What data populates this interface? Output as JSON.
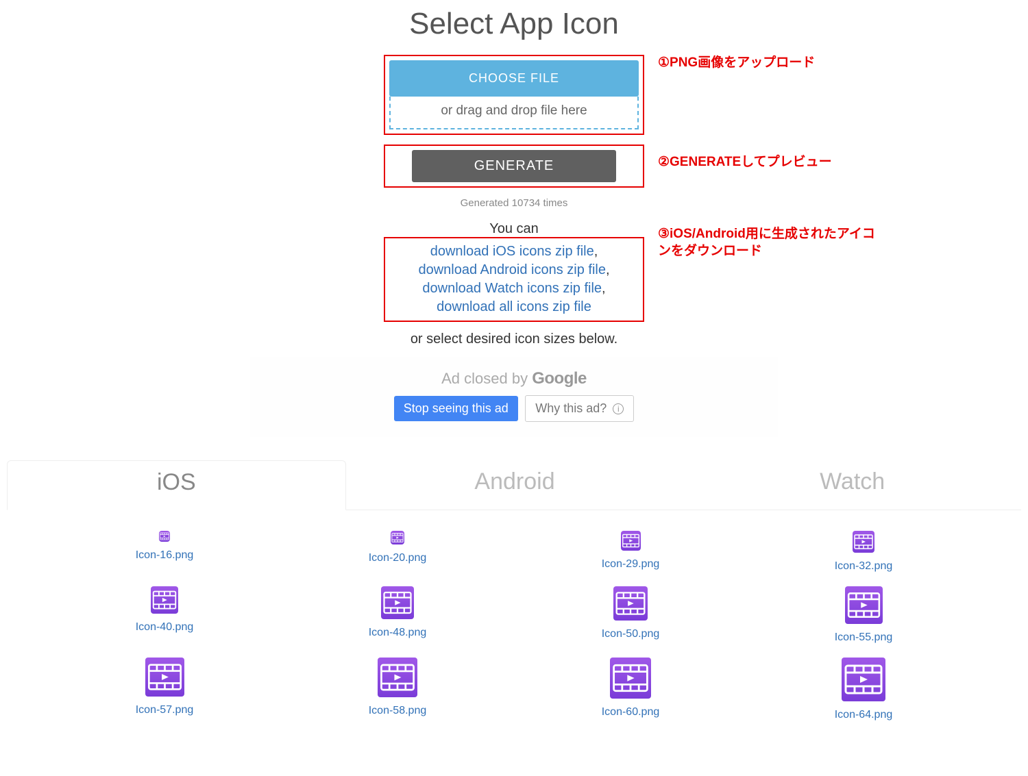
{
  "title": "Select App Icon",
  "upload": {
    "choose": "CHOOSE FILE",
    "drag": "or drag and drop file here"
  },
  "generate": {
    "button": "GENERATE",
    "count_text": "Generated 10734 times"
  },
  "download": {
    "you_can": "You can",
    "ios": "download iOS icons zip file",
    "android": "download Android icons zip file",
    "watch": "download Watch icons zip file",
    "all": "download all icons zip file",
    "comma": ",",
    "or_select": "or select desired icon sizes below."
  },
  "annotations": {
    "a1": "①PNG画像をアップロード",
    "a2": "②GENERATEしてプレビュー",
    "a3": "③iOS/Android用に生成されたアイコンをダウンロード"
  },
  "ad": {
    "closed_prefix": "Ad closed by ",
    "google": "Google",
    "stop": "Stop seeing this ad",
    "why": "Why this ad?"
  },
  "tabs": {
    "ios": "iOS",
    "android": "Android",
    "watch": "Watch"
  },
  "icons": [
    {
      "label": "Icon-16.png",
      "size": 16
    },
    {
      "label": "Icon-20.png",
      "size": 20
    },
    {
      "label": "Icon-29.png",
      "size": 29
    },
    {
      "label": "Icon-32.png",
      "size": 32
    },
    {
      "label": "Icon-40.png",
      "size": 40
    },
    {
      "label": "Icon-48.png",
      "size": 48
    },
    {
      "label": "Icon-50.png",
      "size": 50
    },
    {
      "label": "Icon-55.png",
      "size": 55
    },
    {
      "label": "Icon-57.png",
      "size": 57
    },
    {
      "label": "Icon-58.png",
      "size": 58
    },
    {
      "label": "Icon-60.png",
      "size": 60
    },
    {
      "label": "Icon-64.png",
      "size": 64
    }
  ]
}
